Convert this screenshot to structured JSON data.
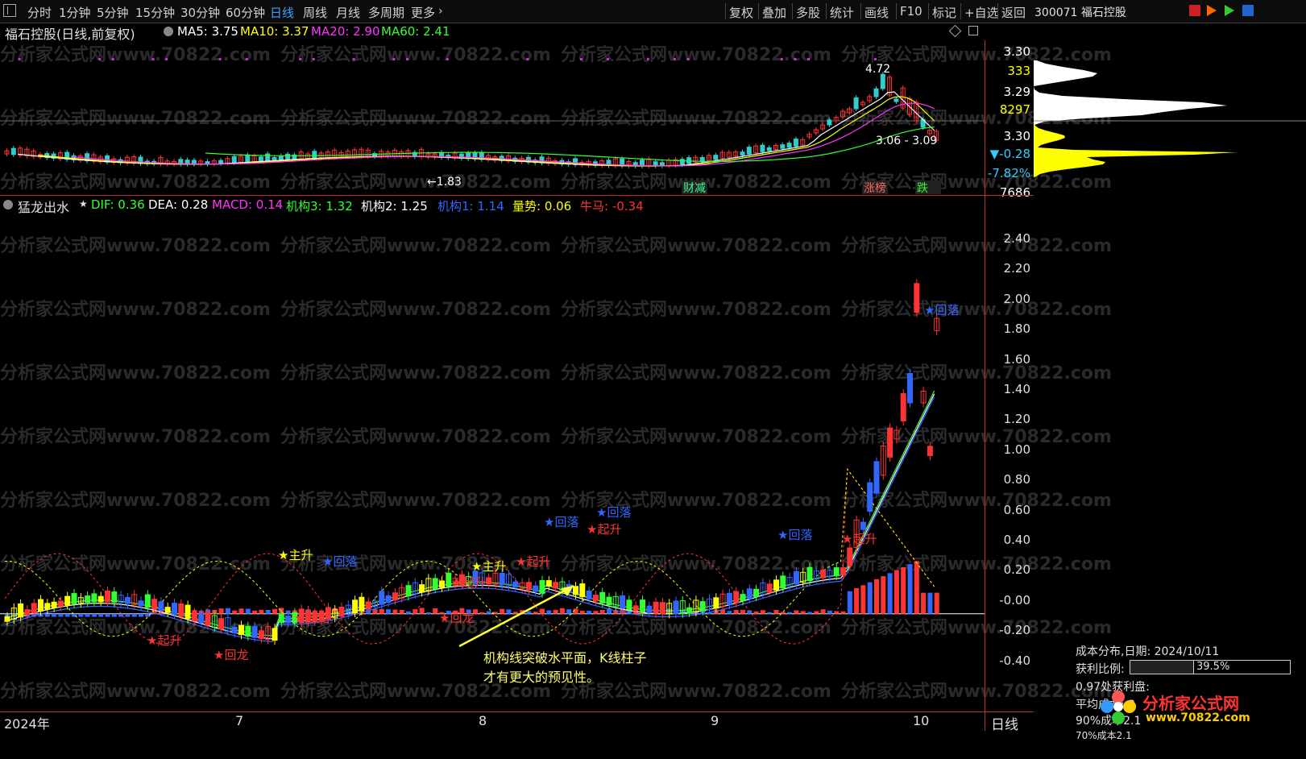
{
  "toolbar": {
    "menu_icon": "menu-icon",
    "periods": [
      "分时",
      "1分钟",
      "5分钟",
      "15分钟",
      "30分钟",
      "60分钟",
      "日线",
      "周线",
      "月线",
      "多周期",
      "更多"
    ],
    "active_period": "日线",
    "actions": [
      "复权",
      "叠加",
      "多股",
      "统计",
      "画线",
      "F10",
      "标记",
      "+自选",
      "返回"
    ]
  },
  "stock": {
    "code_name": "300071 福石控股"
  },
  "main_chart": {
    "title": "福石控股(日线,前复权)",
    "ma": [
      {
        "label": "MA5: 3.75",
        "color": "#ffffff"
      },
      {
        "label": "MA10: 3.37",
        "color": "#ffff00"
      },
      {
        "label": "MA20: 2.90",
        "color": "#ff33ff"
      },
      {
        "label": "MA60: 2.41",
        "color": "#33ff33"
      }
    ],
    "high_label": "4.72",
    "low_label": "1.83",
    "range_label": "3.06 - 3.09",
    "markers": [
      {
        "text": "财减",
        "color": "#33ff99"
      },
      {
        "text": "涨榜",
        "color": "#ff6666"
      },
      {
        "text": "跌",
        "color": "#33ff33"
      }
    ],
    "axis": [
      "3.30",
      "333",
      "3.29",
      "8297",
      "3.30",
      "▼-0.28",
      "-7.82%",
      "7686"
    ],
    "axis_colors": [
      "#ffffff",
      "#ffff00",
      "#ffffff",
      "#ffff00",
      "#ffffff",
      "#33ccff",
      "#33ccff",
      "#ffffff"
    ]
  },
  "indicator": {
    "name": "猛龙出水",
    "values": [
      {
        "label": "DIF: 0.36",
        "color": "#33ff33"
      },
      {
        "label": "DEA: 0.28",
        "color": "#ffffff"
      },
      {
        "label": "MACD: 0.14",
        "color": "#ff33ff"
      },
      {
        "label": "机构3: 1.32",
        "color": "#33ff33"
      },
      {
        "label": "机构2: 1.25",
        "color": "#ffffff"
      },
      {
        "label": "机构1: 1.14",
        "color": "#3366ff"
      },
      {
        "label": "量势: 0.06",
        "color": "#ffff00"
      },
      {
        "label": "牛马: -0.34",
        "color": "#ff3333"
      }
    ],
    "axis": [
      "2.40",
      "2.20",
      "2.00",
      "1.80",
      "1.60",
      "1.40",
      "1.20",
      "1.00",
      "0.80",
      "0.60",
      "0.40",
      "0.20",
      "-0.00",
      "-0.20",
      "-0.40"
    ],
    "signals": [
      {
        "text": "★主升",
        "color": "#ffff00"
      },
      {
        "text": "★回落",
        "color": "#3366ff"
      },
      {
        "text": "★起升",
        "color": "#ff3333"
      },
      {
        "text": "★回龙",
        "color": "#ff3333"
      },
      {
        "text": "★主升",
        "color": "#ffff00"
      },
      {
        "text": "★起升",
        "color": "#ff3333"
      },
      {
        "text": "★回落",
        "color": "#3366ff"
      },
      {
        "text": "★回落",
        "color": "#3366ff"
      },
      {
        "text": "★起升",
        "color": "#ff3333"
      },
      {
        "text": "★回落",
        "color": "#3366ff"
      },
      {
        "text": "★起升",
        "color": "#ff3333"
      },
      {
        "text": "★回落",
        "color": "#3366ff"
      },
      {
        "text": "★起升",
        "color": "#ff3333"
      },
      {
        "text": "★回龙",
        "color": "#ff3333"
      },
      {
        "text": "★回龙",
        "color": "#ff3333"
      }
    ],
    "annotation_line1": "机构线突破水平面，K线柱子",
    "annotation_line2": "才有更大的预见性。"
  },
  "x_axis": {
    "labels": [
      "2024年",
      "7",
      "8",
      "9",
      "10"
    ],
    "period_label": "日线"
  },
  "cost_distribution": {
    "title": "成本分布,日期: 2024/10/11",
    "profit_label": "获利比例:",
    "profit_value": "39.5%",
    "profit_fraction": 0.395,
    "profit_price": "0.97处获利盘:",
    "avg_cost": "平均成本: 3",
    "cost90": "90%成本2.1",
    "cost70": "70%成本2.1"
  },
  "watermark": {
    "text": "分析家公式网www.70822.com",
    "logo_title": "分析家公式网",
    "logo_url": "www.70822.com"
  }
}
